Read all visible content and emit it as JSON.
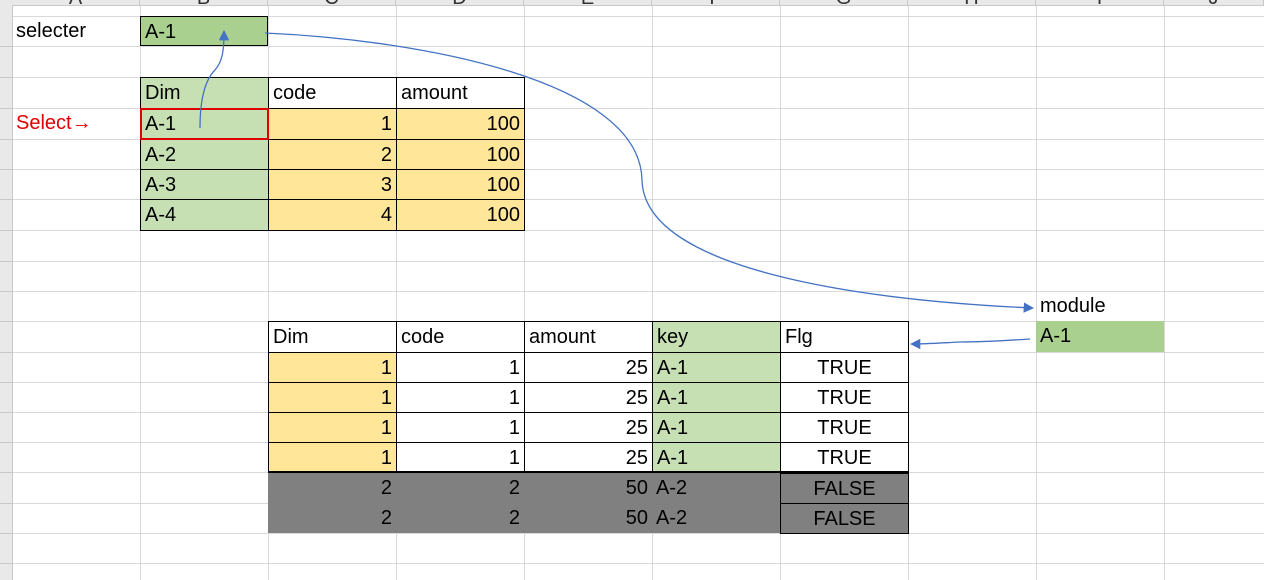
{
  "column_headers": [
    "A",
    "B",
    "C",
    "D",
    "E",
    "F",
    "G",
    "H",
    "I",
    "J"
  ],
  "labels": {
    "selecter": "selecter",
    "select_arrow": "Select→",
    "module": "module"
  },
  "selecter_value": "A-1",
  "module_value": "A-1",
  "table1": {
    "headers": [
      "Dim",
      "code",
      "amount"
    ],
    "rows": [
      {
        "dim": "A-1",
        "code": "1",
        "amount": "100"
      },
      {
        "dim": "A-2",
        "code": "2",
        "amount": "100"
      },
      {
        "dim": "A-3",
        "code": "3",
        "amount": "100"
      },
      {
        "dim": "A-4",
        "code": "4",
        "amount": "100"
      }
    ]
  },
  "table2": {
    "headers": [
      "Dim",
      "code",
      "amount",
      "key",
      "Flg"
    ],
    "rows": [
      {
        "dim": "1",
        "code": "1",
        "amount": "25",
        "key": "A-1",
        "flg": "TRUE"
      },
      {
        "dim": "1",
        "code": "1",
        "amount": "25",
        "key": "A-1",
        "flg": "TRUE"
      },
      {
        "dim": "1",
        "code": "1",
        "amount": "25",
        "key": "A-1",
        "flg": "TRUE"
      },
      {
        "dim": "1",
        "code": "1",
        "amount": "25",
        "key": "A-1",
        "flg": "TRUE"
      },
      {
        "dim": "2",
        "code": "2",
        "amount": "50",
        "key": "A-2",
        "flg": "FALSE"
      },
      {
        "dim": "2",
        "code": "2",
        "amount": "50",
        "key": "A-2",
        "flg": "FALSE"
      }
    ]
  },
  "colors": {
    "dim_green": "#c6e0b4",
    "selecter_green": "#a9d08e",
    "value_yellow": "#ffe699",
    "filtered_gray": "#808080",
    "arrow_blue": "#4472c4",
    "select_red": "#e00000"
  }
}
